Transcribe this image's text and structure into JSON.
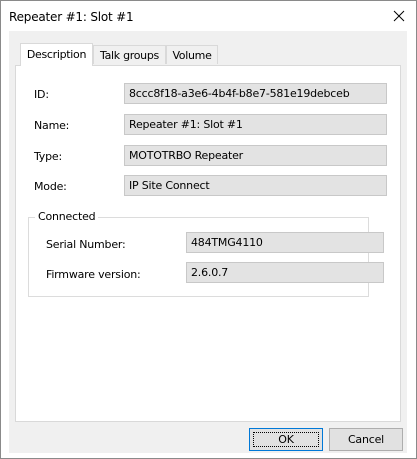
{
  "window": {
    "title": "Repeater #1: Slot #1",
    "close_glyph": "✕"
  },
  "tabs": [
    {
      "label": "Description",
      "active": true
    },
    {
      "label": "Talk groups",
      "active": false
    },
    {
      "label": "Volume",
      "active": false
    }
  ],
  "fields": {
    "id": {
      "label": "ID:",
      "value": "8ccc8f18-a3e6-4b4f-b8e7-581e19debceb"
    },
    "name": {
      "label": "Name:",
      "value": "Repeater #1: Slot #1"
    },
    "type": {
      "label": "Type:",
      "value": "MOTOTRBO Repeater"
    },
    "mode": {
      "label": "Mode:",
      "value": "IP Site Connect"
    }
  },
  "connected": {
    "legend": "Connected",
    "serial_number": {
      "label": "Serial Number:",
      "value": "484TMG4110"
    },
    "firmware_version": {
      "label": "Firmware version:",
      "value": "2.6.0.7"
    }
  },
  "buttons": {
    "ok": "OK",
    "cancel": "Cancel"
  },
  "colors": {
    "field_background": "#e3e3e3",
    "dialog_background": "#f0f0f0",
    "default_button_border": "#0078d7"
  }
}
